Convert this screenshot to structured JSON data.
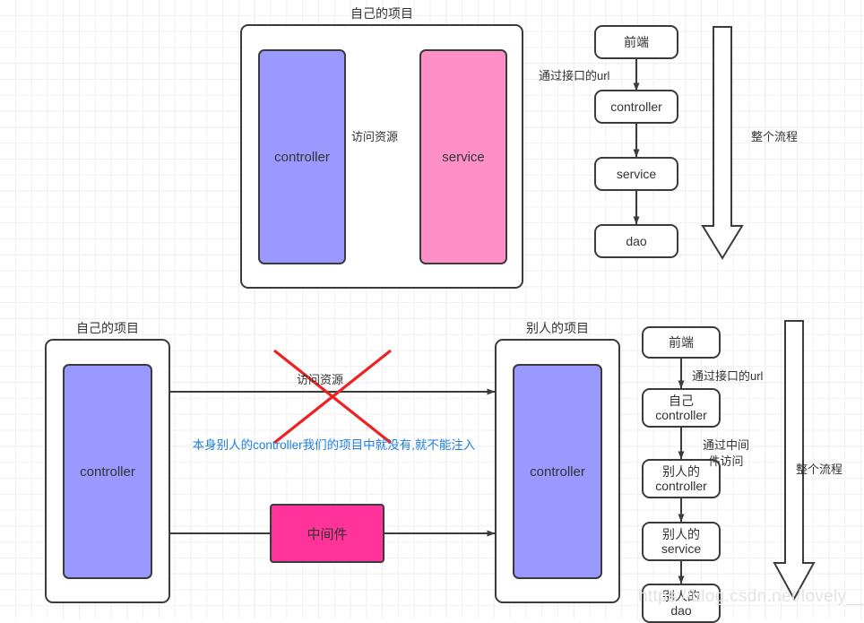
{
  "diagram": {
    "title_top_left": "自己的项目",
    "watermark": "https://blog.csdn.net/lovely__RR",
    "colors": {
      "purple": "#9999ff",
      "pink": "#ff8fc7",
      "magenta": "#ff3399",
      "stroke": "#3b3b3b",
      "red_cross": "#ee2222",
      "blue_note": "#1f7de8",
      "grid_minor": "#f0f0f0",
      "grid_major": "#e6e6e6"
    }
  },
  "top_section": {
    "project_label": "自己的项目",
    "controller": "controller",
    "service": "service",
    "arrow_label": "访问资源"
  },
  "top_flow": {
    "nodes": [
      {
        "label": "前端"
      },
      {
        "label": "controller"
      },
      {
        "label": "service"
      },
      {
        "label": "dao"
      }
    ],
    "edge_label": "通过接口的url",
    "big_arrow_label": "整个流程"
  },
  "bottom_section": {
    "own_project_label": "自己的项目",
    "own_controller": "controller",
    "other_project_label": "别人的项目",
    "other_controller": "controller",
    "middleware": "中间件",
    "blocked_arrow_label": "访问资源",
    "note": "本身别人的controller我们的项目中就没有,就不能注入"
  },
  "bottom_flow": {
    "nodes": [
      {
        "line1": "前端",
        "line2": ""
      },
      {
        "line1": "自己",
        "line2": "controller"
      },
      {
        "line1": "别人的",
        "line2": "controller"
      },
      {
        "line1": "别人的",
        "line2": "service"
      },
      {
        "line1": "别人的",
        "line2": "dao"
      }
    ],
    "edge_label_1": "通过接口的url",
    "edge_label_2_line1": "通过中间",
    "edge_label_2_line2": "件访问",
    "big_arrow_label": "整个流程"
  }
}
